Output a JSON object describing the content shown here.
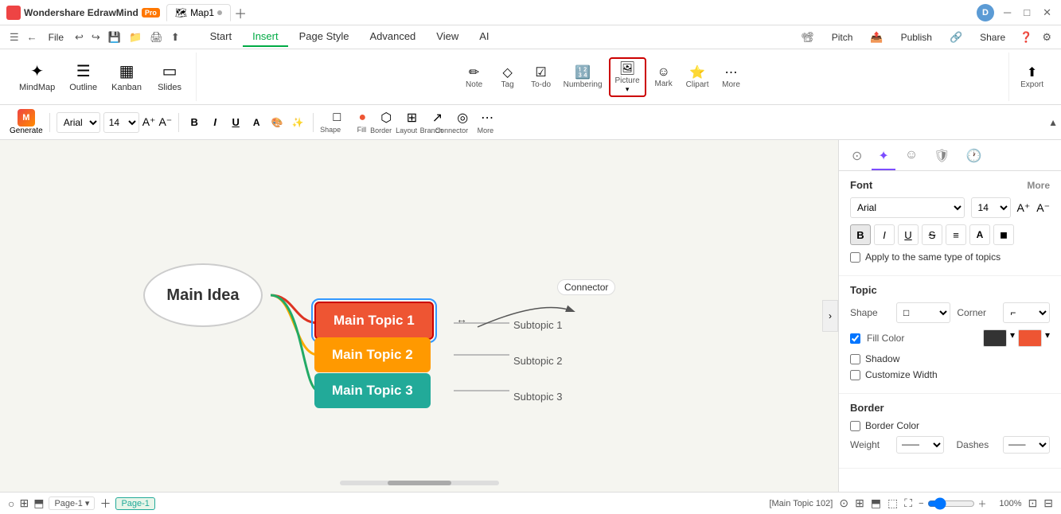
{
  "app": {
    "name": "Wondershare EdrawMind",
    "badge": "Pro",
    "tab_name": "Map1",
    "avatar": "D"
  },
  "menu": {
    "file": "File",
    "tabs": [
      "Start",
      "Insert",
      "Page Style",
      "Advanced",
      "View",
      "AI"
    ],
    "active_tab": "Insert",
    "pitch": "Pitch",
    "publish": "Publish",
    "share": "Share"
  },
  "ribbon": {
    "items": [
      {
        "id": "mindmap",
        "label": "MindMap",
        "icon": "✦"
      },
      {
        "id": "outline",
        "label": "Outline",
        "icon": "☰"
      },
      {
        "id": "kanban",
        "label": "Kanban",
        "icon": "▦"
      },
      {
        "id": "slides",
        "label": "Slides",
        "icon": "▭"
      }
    ],
    "insert_items": [
      {
        "id": "note",
        "label": "Note",
        "icon": "✏"
      },
      {
        "id": "tag",
        "label": "Tag",
        "icon": "◇"
      },
      {
        "id": "todo",
        "label": "To-do",
        "icon": "▦"
      },
      {
        "id": "numbering",
        "label": "Numbering",
        "icon": "☰"
      },
      {
        "id": "picture",
        "label": "Picture",
        "icon": "🖼",
        "selected": true
      },
      {
        "id": "mark",
        "label": "Mark",
        "icon": "☺"
      },
      {
        "id": "clipart",
        "label": "Clipart",
        "icon": "⭐"
      },
      {
        "id": "more",
        "label": "More",
        "icon": "⋯"
      }
    ],
    "export_label": "Export"
  },
  "toolbar": {
    "generate_label": "Generate",
    "font": "Arial",
    "font_size": "14",
    "bold": "B",
    "italic": "I",
    "underline": "U",
    "shapes": [
      "Shape",
      "Fill",
      "Border",
      "Layout",
      "Branch",
      "Connector",
      "More"
    ]
  },
  "mindmap": {
    "main_idea": "Main Idea",
    "topics": [
      {
        "id": 1,
        "label": "Main Topic 1",
        "color": "red",
        "subtopic": "Subtopic 1",
        "selected": true
      },
      {
        "id": 2,
        "label": "Main Topic 2",
        "color": "orange",
        "subtopic": "Subtopic 2"
      },
      {
        "id": 3,
        "label": "Main Topic 3",
        "color": "green",
        "subtopic": "Subtopic 3"
      }
    ],
    "connector_label": "Connector"
  },
  "right_panel": {
    "tabs": [
      "topic-icon",
      "sparkle-icon",
      "emoji-icon",
      "shield-icon",
      "clock-icon"
    ],
    "font_section": {
      "title": "Font",
      "more": "More",
      "font_name": "Arial",
      "font_size": "14",
      "bold": "B",
      "italic": "I",
      "underline": "U",
      "strikethrough": "S",
      "align": "≡",
      "text_color": "A",
      "highlight": "◼"
    },
    "checkbox_label": "Apply to the same type of topics",
    "topic_section": {
      "title": "Topic",
      "shape_label": "Shape",
      "corner_label": "Corner",
      "fill_color_label": "Fill Color",
      "shadow_label": "Shadow",
      "customize_width_label": "Customize Width"
    },
    "border_section": {
      "title": "Border",
      "border_color_label": "Border Color",
      "weight_label": "Weight",
      "dashes_label": "Dashes"
    }
  },
  "status_bar": {
    "page_label": "Page-1",
    "page_active": "Page-1",
    "status_info": "[Main Topic 102]",
    "zoom": "100%"
  }
}
